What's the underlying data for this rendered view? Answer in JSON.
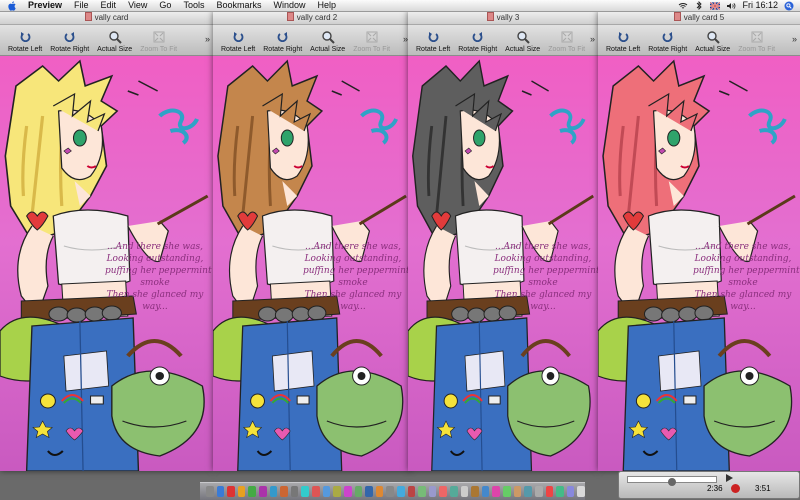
{
  "menubar": {
    "app_name": "Preview",
    "menus": [
      "File",
      "Edit",
      "View",
      "Go",
      "Tools",
      "Bookmarks",
      "Window",
      "Help"
    ],
    "clock": "Fri 16:12"
  },
  "toolbar": {
    "rotate_left": "Rotate Left",
    "rotate_right": "Rotate Right",
    "actual_size": "Actual Size",
    "zoom_to_fit": "Zoom To Fit",
    "overflow": "»"
  },
  "windows": [
    {
      "title": "vally card",
      "hair_color": "#f7e67a",
      "hair_shade": "#d9b94a"
    },
    {
      "title": "vally card 2",
      "hair_color": "#c4864c",
      "hair_shade": "#8e5a2c"
    },
    {
      "title": "vally 3",
      "hair_color": "#5e5e5e",
      "hair_shade": "#333333"
    },
    {
      "title": "vally card 5",
      "hair_color": "#ee6f79",
      "hair_shade": "#c14a55"
    }
  ],
  "poem_lines": [
    "...And there she was,",
    "Looking outstanding,",
    "puffing her peppermint",
    "smoke",
    "Then she glanced my",
    "way..."
  ],
  "quicktime": {
    "elapsed": "2:36",
    "duration": "3:51"
  },
  "colors": {
    "background_pink": "#f05fc4",
    "jeans": "#3a6fc0",
    "top": "#f4f0f0",
    "frog": "#8cc070"
  }
}
